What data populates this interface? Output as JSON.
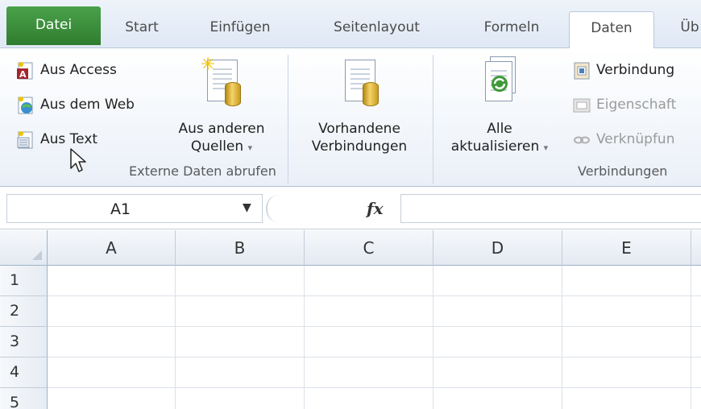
{
  "tabs": [
    "Datei",
    "Start",
    "Einfügen",
    "Seitenlayout",
    "Formeln",
    "Daten",
    "Üb"
  ],
  "ribbon": {
    "externe": {
      "group_label": "Externe Daten abrufen",
      "aus_access": "Aus Access",
      "aus_web": "Aus dem Web",
      "aus_text": "Aus Text",
      "aus_anderen_1": "Aus anderen",
      "aus_anderen_2": "Quellen",
      "vorhandene_1": "Vorhandene",
      "vorhandene_2": "Verbindungen"
    },
    "verbindungen": {
      "group_label": "Verbindungen",
      "alle_1": "Alle",
      "alle_2": "aktualisieren",
      "verbindungen": "Verbindung",
      "eigenschaften": "Eigenschaft",
      "verknuepfungen": "Verknüpfun"
    },
    "dropdown_glyph": "▾"
  },
  "formula_bar": {
    "name_box": "A1",
    "fx": "fx",
    "formula": ""
  },
  "grid": {
    "columns": [
      "A",
      "B",
      "C",
      "D",
      "E"
    ],
    "rows": [
      "1",
      "2",
      "3",
      "4",
      "5"
    ]
  },
  "colors": {
    "file_tab": "#2f7d2f",
    "ribbon_bg": "#eaf0f8"
  }
}
